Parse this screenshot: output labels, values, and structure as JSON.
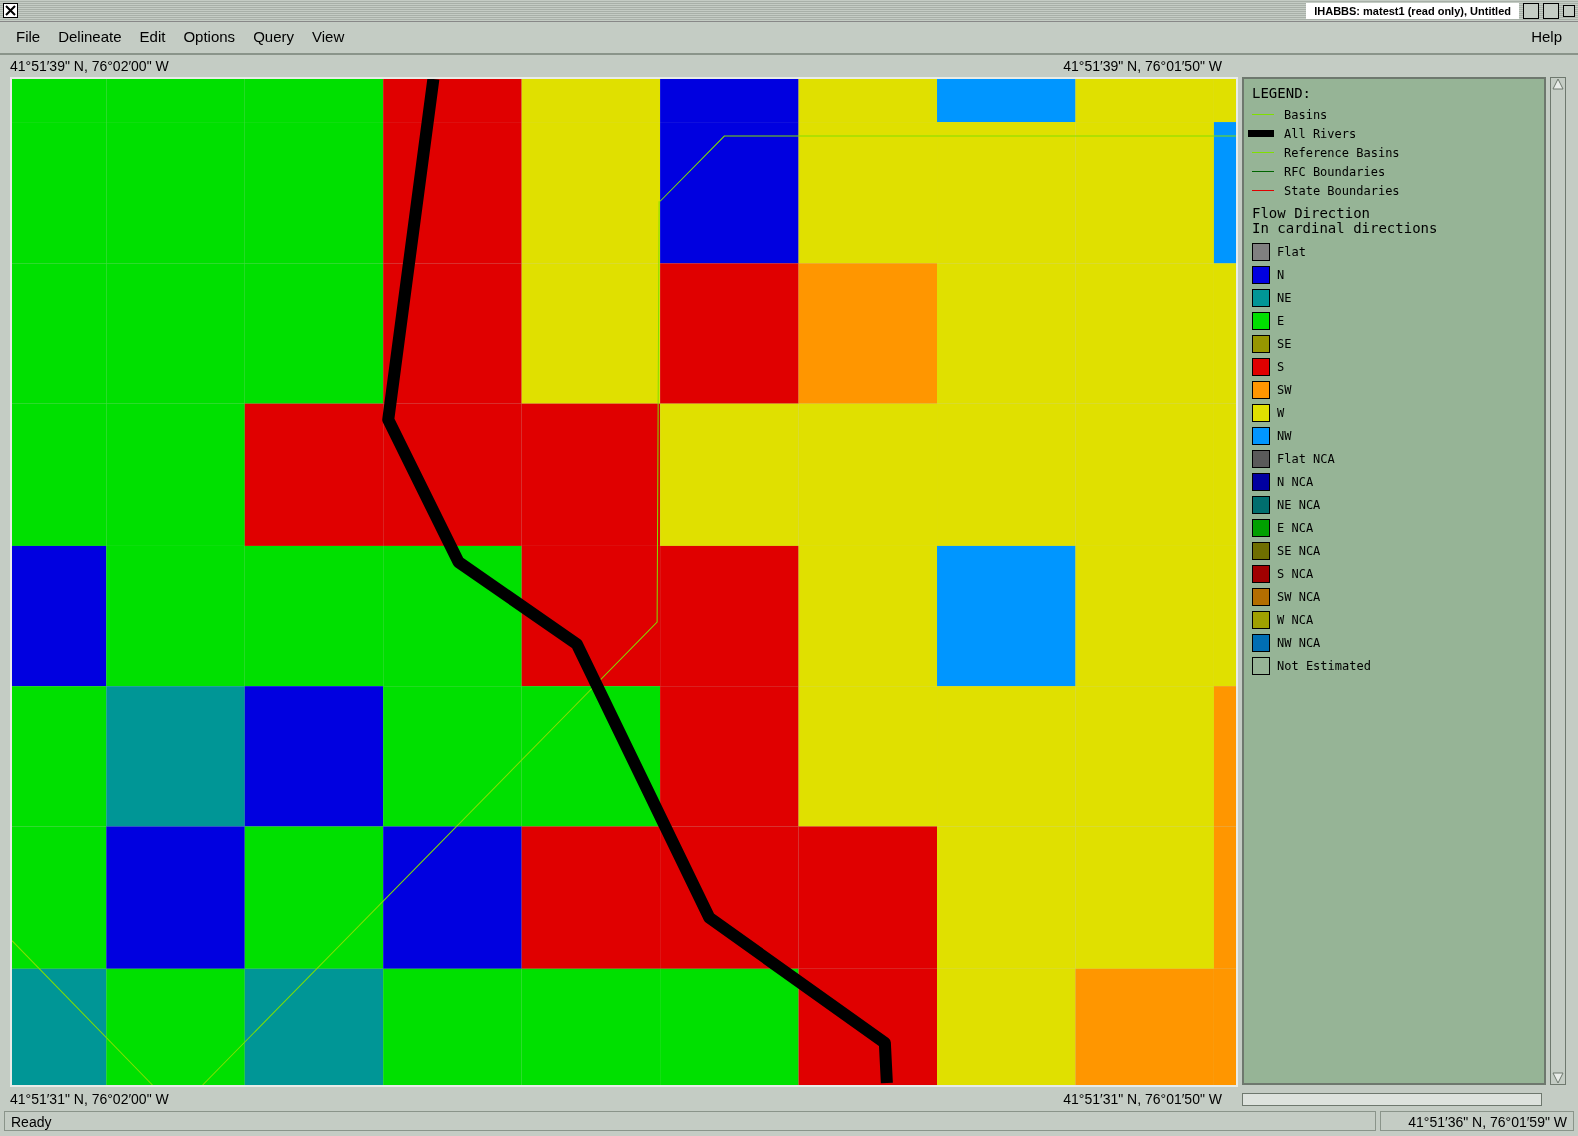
{
  "window": {
    "title": "IHABBS:  matest1 (read only),  Untitled"
  },
  "menu": [
    {
      "label": "File"
    },
    {
      "label": "Delineate"
    },
    {
      "label": "Edit"
    },
    {
      "label": "Options"
    },
    {
      "label": "Query"
    },
    {
      "label": "View"
    }
  ],
  "help_menu": "Help",
  "map": {
    "top_left": "41°51′39\" N, 76°02′00\" W",
    "top_right": "41°51′39\" N, 76°01′50\" W",
    "bottom_left": "41°51′31\" N, 76°02′00\" W",
    "bottom_right": "41°51′31\" N, 76°01′50\" W"
  },
  "legend": {
    "title": "LEGEND:",
    "layers": [
      {
        "label": "Basins",
        "kind": "thin",
        "color": "#80e000"
      },
      {
        "label": "All Rivers",
        "kind": "thick",
        "color": "#000000"
      },
      {
        "label": "Reference Basins",
        "kind": "thin",
        "color": "#80e000"
      },
      {
        "label": "RFC Boundaries",
        "kind": "thin",
        "color": "#006400"
      },
      {
        "label": "State Boundaries",
        "kind": "thin",
        "color": "#e00000"
      }
    ],
    "section_title": [
      "Flow Direction",
      "In cardinal directions"
    ],
    "classes": [
      {
        "label": "Flat",
        "color": "#808080"
      },
      {
        "label": "N",
        "color": "#0000e0"
      },
      {
        "label": "NE",
        "color": "#009696"
      },
      {
        "label": "E",
        "color": "#00e000"
      },
      {
        "label": "SE",
        "color": "#969600"
      },
      {
        "label": "S",
        "color": "#e00000"
      },
      {
        "label": "SW",
        "color": "#ff9600"
      },
      {
        "label": "W",
        "color": "#e0e000"
      },
      {
        "label": "NW",
        "color": "#0096ff"
      },
      {
        "label": "Flat NCA",
        "color": "#5a5a5a"
      },
      {
        "label": "N NCA",
        "color": "#0000a0"
      },
      {
        "label": "NE NCA",
        "color": "#006e6e"
      },
      {
        "label": "E NCA",
        "color": "#00a000"
      },
      {
        "label": "SE NCA",
        "color": "#6e6e00"
      },
      {
        "label": "S NCA",
        "color": "#a00000"
      },
      {
        "label": "SW NCA",
        "color": "#b46e00"
      },
      {
        "label": "W NCA",
        "color": "#a0a000"
      },
      {
        "label": "NW NCA",
        "color": "#006eb4"
      },
      {
        "label": "Not Estimated",
        "color": "#96b496"
      }
    ]
  },
  "status_bar": {
    "message": "Ready",
    "cursor": "41°51′36\" N, 76°01′59\" W"
  }
}
